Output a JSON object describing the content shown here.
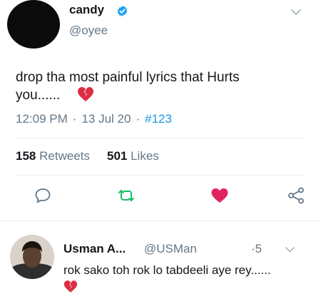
{
  "tweet": {
    "author_name": "candy",
    "author_handle": "@oyee",
    "text_line1": "drop tha most painful lyrics that Hurts",
    "text_line2": "you......",
    "time": "12:09 PM",
    "date": "13 Jul 20",
    "tag": "#123",
    "retweets_count": "158",
    "retweets_label": "Retweets",
    "likes_count": "501",
    "likes_label": "Likes"
  },
  "reply": {
    "author_name": "Usman A...",
    "author_handle": "@USMan",
    "time": "5",
    "text": "rok sako toh rok lo tabdeeli aye rey......"
  },
  "colors": {
    "accent_blue": "#1b95e0",
    "secondary_text": "#657786",
    "like_red": "#e0245e",
    "retweet_green": "#17bf63"
  },
  "icons": {
    "verified": "verified-badge-icon",
    "reply": "reply-icon",
    "retweet": "retweet-icon",
    "like": "heart-icon",
    "share": "share-icon",
    "emoji": "broken-heart-icon"
  }
}
